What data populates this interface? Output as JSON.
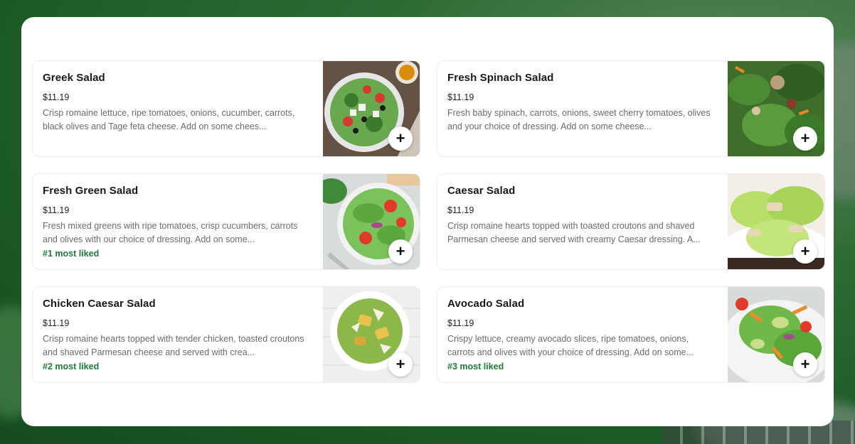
{
  "menu": {
    "items": [
      {
        "name": "Greek Salad",
        "price": "$11.19",
        "description": "Crisp romaine lettuce, ripe tomatoes, onions, cucumber, carrots, black olives and Tage feta cheese. Add on some chees...",
        "badge": "",
        "add_icon": "plus-icon",
        "add_label": "+"
      },
      {
        "name": "Fresh Spinach Salad",
        "price": "$11.19",
        "description": "Fresh baby spinach, carrots, onions, sweet cherry tomatoes, olives and your choice of dressing. Add on some cheese...",
        "badge": "",
        "add_icon": "plus-icon",
        "add_label": "+"
      },
      {
        "name": "Fresh Green Salad",
        "price": "$11.19",
        "description": "Fresh mixed greens with ripe tomatoes, crisp cucumbers, carrots and olives with our choice of dressing. Add on some...",
        "badge": "#1 most liked",
        "add_icon": "plus-icon",
        "add_label": "+"
      },
      {
        "name": "Caesar Salad",
        "price": "$11.19",
        "description": "Crisp romaine hearts topped with toasted croutons and shaved Parmesan cheese and served with creamy Caesar dressing. A...",
        "badge": "",
        "add_icon": "plus-icon",
        "add_label": "+"
      },
      {
        "name": "Chicken Caesar Salad",
        "price": "$11.19",
        "description": "Crisp romaine hearts topped with tender chicken, toasted croutons and shaved Parmesan cheese and served with crea...",
        "badge": "#2 most liked",
        "add_icon": "plus-icon",
        "add_label": "+"
      },
      {
        "name": "Avocado Salad",
        "price": "$11.19",
        "description": "Crispy lettuce, creamy avocado slices, ripe tomatoes, onions, carrots and olives with your choice of dressing. Add on some...",
        "badge": "#3 most liked",
        "add_icon": "plus-icon",
        "add_label": "+"
      }
    ]
  },
  "colors": {
    "badge_green": "#1f7a3a",
    "background_green": "#2f6b35"
  }
}
